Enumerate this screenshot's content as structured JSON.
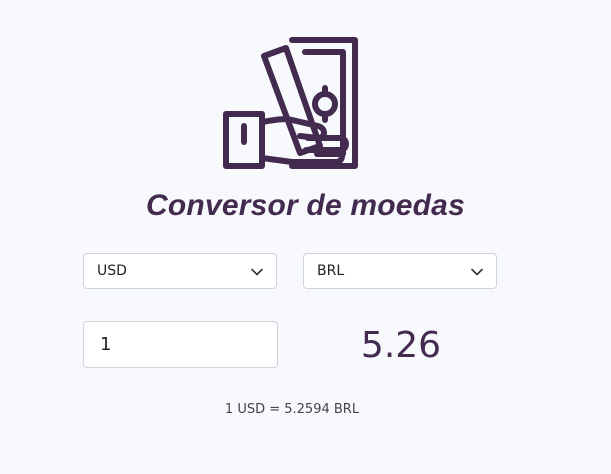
{
  "app": {
    "title": "Conversor de moedas",
    "logo_icon": "cash-in-hand-icon",
    "accent_color": "#432b4f"
  },
  "converter": {
    "from_currency": "USD",
    "to_currency": "BRL",
    "amount": "1",
    "result": "5.26",
    "rate_text": "1 USD = 5.2594 BRL"
  }
}
